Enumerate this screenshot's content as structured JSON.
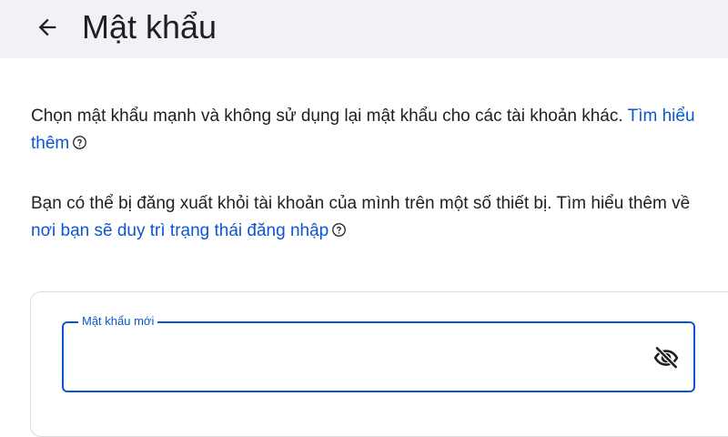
{
  "header": {
    "title": "Mật khẩu",
    "back_icon": "arrow-back-icon"
  },
  "intro": {
    "text": "Chọn mật khẩu mạnh và không sử dụng lại mật khẩu cho các tài khoản khác.",
    "link": "Tìm hiểu thêm",
    "link_icon": "help-circle-icon"
  },
  "signout_notice": {
    "text": "Bạn có thể bị đăng xuất khỏi tài khoản của mình trên một số thiết bị. Tìm hiểu thêm về",
    "link": "nơi bạn sẽ duy trì trạng thái đăng nhập",
    "link_icon": "help-circle-icon"
  },
  "new_password_field": {
    "label": "Mật khẩu mới",
    "value": "",
    "toggle_icon": "visibility-off-icon"
  },
  "colors": {
    "header_bg": "#f0f2f5",
    "text": "#1f1f1f",
    "link": "#0b57d0",
    "field_border": "#0b57d0",
    "card_border": "#dadce0"
  }
}
